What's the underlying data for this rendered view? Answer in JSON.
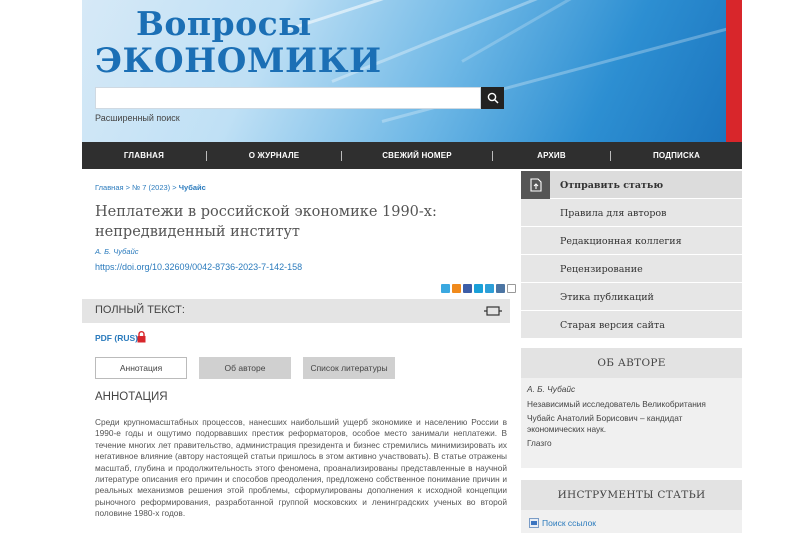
{
  "header": {
    "logo_line1": "Вопросы",
    "logo_line2": "ЭКОНОМИКИ",
    "search_placeholder": "",
    "advanced_search": "Расширенный поиск"
  },
  "nav": {
    "items": [
      "ГЛАВНАЯ",
      "О ЖУРНАЛЕ",
      "СВЕЖИЙ НОМЕР",
      "АРХИВ",
      "ПОДПИСКА"
    ]
  },
  "breadcrumb": {
    "home": "Главная",
    "sep": " > ",
    "issue": "№ 7 (2023)",
    "current": "Чубайс"
  },
  "article": {
    "title": "Неплатежи в российской экономике 1990-х: непредвиденный институт",
    "author": "А. Б. Чубайс",
    "doi": "https://doi.org/10.32609/0042-8736-2023-7-142-158",
    "fulltext_label": "ПОЛНЫЙ ТЕКСТ:",
    "pdf_link": "PDF (RUS)",
    "tabs": [
      "Аннотация",
      "Об авторе",
      "Список литературы"
    ],
    "abstract_heading": "АННОТАЦИЯ",
    "abstract": "Среди крупномасштабных процессов, нанесших наибольший ущерб экономике и населению России в 1990-е годы и ощутимо подорвавших престиж реформаторов, особое место занимали неплатежи. В течение многих лет правительство, администрация президента и бизнес стремились минимизировать их негативное влияние (автору настоящей статьи пришлось в этом активно участвовать). В статье отражены масштаб, глубина и продолжительность этого феномена, проанализированы представленные в научной литературе описания его причин и способов преодоления, предложено собственное понимание причин и реальных механизмов решения этой проблемы, сформулированы дополнения к исходной концепции рыночного реформирования, разработанной группой московских и ленинградских ученых во второй половине 1980-х годов."
  },
  "sidebar": {
    "menu": [
      "Отправить статью",
      "Правила для авторов",
      "Редакционная коллегия",
      "Рецензирование",
      "Этика публикаций",
      "Старая версия сайта"
    ],
    "about_author_title": "ОБ АВТОРЕ",
    "author_name": "А. Б. Чубайс",
    "author_affil": "Независимый исследователь Великобритания",
    "author_desc": "Чубайс Анатолий Борисович – кандидат экономических наук.",
    "author_city": "Глазго",
    "tools_title": "ИНСТРУМЕНТЫ СТАТЬИ",
    "tools_link": "Поиск ссылок"
  },
  "colors": {
    "brand_blue": "#1b6fb5",
    "link_blue": "#2b7bbd",
    "nav_bg": "#2f2f2f",
    "accent_red": "#d8262b"
  }
}
